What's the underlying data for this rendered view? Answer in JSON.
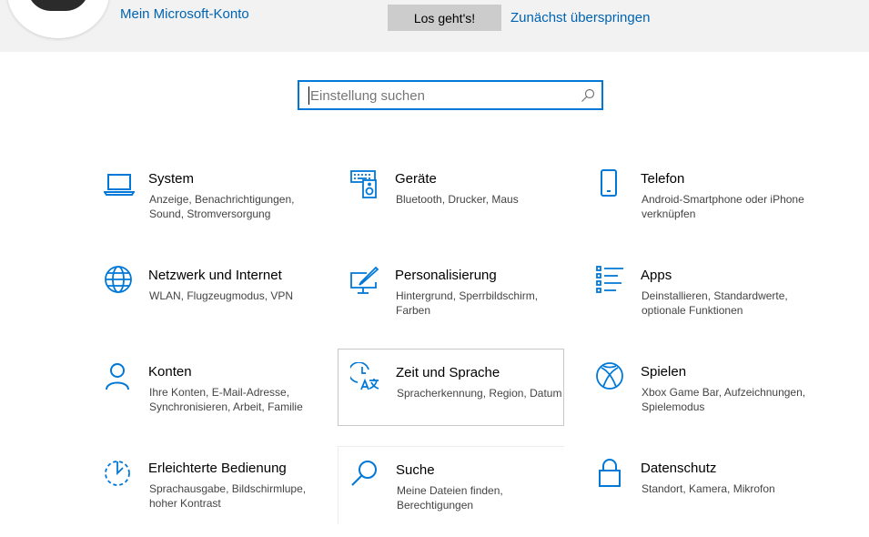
{
  "banner": {
    "account_link": "Mein Microsoft-Konto",
    "go_button": "Los geht's!",
    "skip_link": "Zunächst überspringen"
  },
  "search": {
    "placeholder": "Einstellung suchen",
    "value": ""
  },
  "accent_color": "#0078d7",
  "link_color": "#0063b1",
  "categories": [
    {
      "title": "System",
      "desc": "Anzeige, Benachrichtigungen, Sound, Stromversorgung",
      "icon": "laptop-icon"
    },
    {
      "title": "Geräte",
      "desc": "Bluetooth, Drucker, Maus",
      "icon": "keyboard-speaker-icon"
    },
    {
      "title": "Telefon",
      "desc": "Android-Smartphone oder iPhone verknüpfen",
      "icon": "phone-icon"
    },
    {
      "title": "Netzwerk und Internet",
      "desc": "WLAN, Flugzeugmodus, VPN",
      "icon": "globe-icon"
    },
    {
      "title": "Personalisierung",
      "desc": "Hintergrund, Sperrbildschirm, Farben",
      "icon": "paint-monitor-icon"
    },
    {
      "title": "Apps",
      "desc": "Deinstallieren, Standardwerte, optionale Funktionen",
      "icon": "app-list-icon"
    },
    {
      "title": "Konten",
      "desc": "Ihre Konten, E-Mail-Adresse, Synchronisieren, Arbeit, Familie",
      "icon": "person-icon"
    },
    {
      "title": "Zeit und Sprache",
      "desc": "Spracherkennung, Region, Datum",
      "icon": "time-language-icon"
    },
    {
      "title": "Spielen",
      "desc": "Xbox Game Bar, Aufzeichnungen, Spielemodus",
      "icon": "xbox-icon"
    },
    {
      "title": "Erleichterte Bedienung",
      "desc": "Sprachausgabe, Bildschirmlupe, hoher Kontrast",
      "icon": "accessibility-timer-icon"
    },
    {
      "title": "Suche",
      "desc": "Meine Dateien finden, Berechtigungen",
      "icon": "magnifier-icon"
    },
    {
      "title": "Datenschutz",
      "desc": "Standort, Kamera, Mikrofon",
      "icon": "lock-icon"
    }
  ]
}
